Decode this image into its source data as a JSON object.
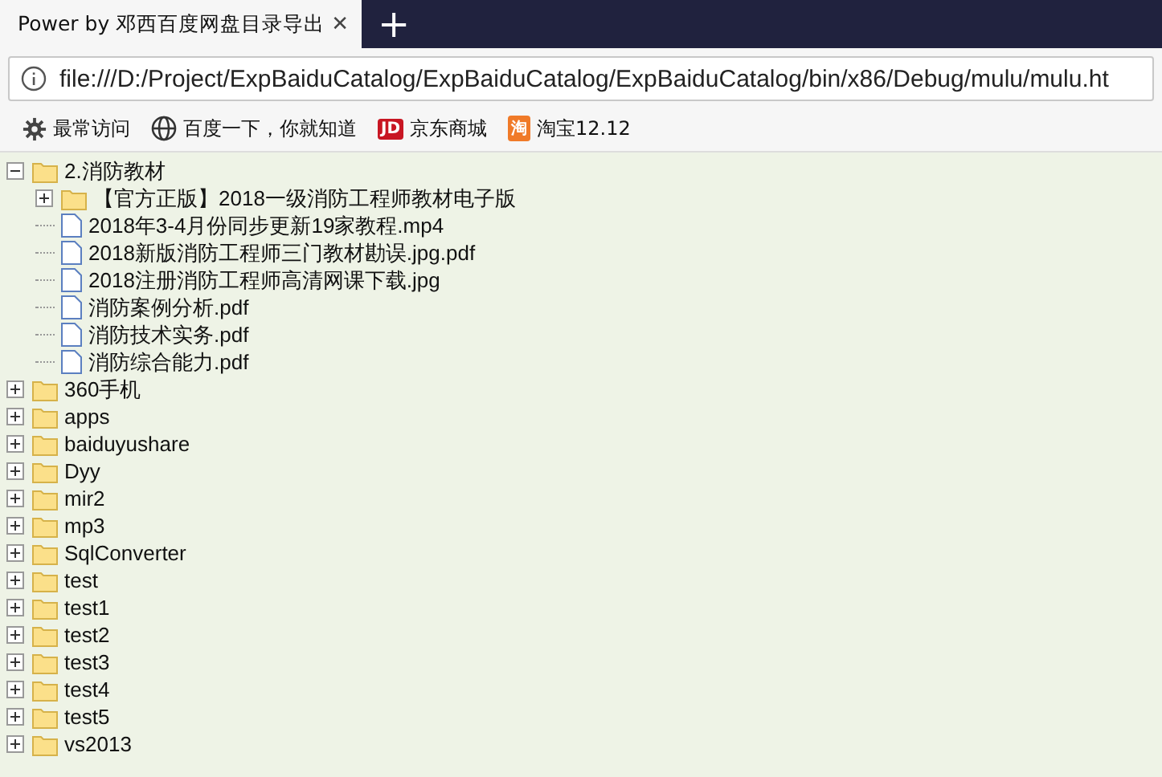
{
  "tabs": [
    {
      "title": "Power by 邓西百度网盘目录导出",
      "selected": true,
      "close": "✕"
    }
  ],
  "new_tab": "+",
  "address_bar": {
    "url": "file:///D:/Project/ExpBaiduCatalog/ExpBaiduCatalog/ExpBaiduCatalog/bin/x86/Debug/mulu/mulu.ht"
  },
  "bookmarks": [
    {
      "kind": "gear",
      "label": "最常访问"
    },
    {
      "kind": "globe",
      "label": "百度一下，你就知道"
    },
    {
      "kind": "badge",
      "badge": "JD",
      "color": "#c81623",
      "label": "京东商城"
    },
    {
      "kind": "badge",
      "badge": "淘",
      "color": "#f07a28",
      "label": "淘宝12.12"
    }
  ],
  "tree": [
    {
      "kind": "folder",
      "name": "2.消防教材",
      "expanded": true,
      "children": [
        {
          "kind": "folder",
          "name": "【官方正版】2018一级消防工程师教材电子版",
          "expanded": false
        },
        {
          "kind": "file",
          "name": "2018年3-4月份同步更新19家教程.mp4"
        },
        {
          "kind": "file",
          "name": "2018新版消防工程师三门教材勘误.jpg.pdf"
        },
        {
          "kind": "file",
          "name": "2018注册消防工程师高清网课下载.jpg"
        },
        {
          "kind": "file",
          "name": "消防案例分析.pdf"
        },
        {
          "kind": "file",
          "name": "消防技术实务.pdf"
        },
        {
          "kind": "file",
          "name": "消防综合能力.pdf"
        }
      ]
    },
    {
      "kind": "folder",
      "name": "360手机",
      "expanded": false
    },
    {
      "kind": "folder",
      "name": "apps",
      "expanded": false
    },
    {
      "kind": "folder",
      "name": "baiduyushare",
      "expanded": false
    },
    {
      "kind": "folder",
      "name": "Dyy",
      "expanded": false
    },
    {
      "kind": "folder",
      "name": "mir2",
      "expanded": false
    },
    {
      "kind": "folder",
      "name": "mp3",
      "expanded": false
    },
    {
      "kind": "folder",
      "name": "SqlConverter",
      "expanded": false
    },
    {
      "kind": "folder",
      "name": "test",
      "expanded": false
    },
    {
      "kind": "folder",
      "name": "test1",
      "expanded": false
    },
    {
      "kind": "folder",
      "name": "test2",
      "expanded": false
    },
    {
      "kind": "folder",
      "name": "test3",
      "expanded": false
    },
    {
      "kind": "folder",
      "name": "test4",
      "expanded": false
    },
    {
      "kind": "folder",
      "name": "test5",
      "expanded": false
    },
    {
      "kind": "folder",
      "name": "vs2013",
      "expanded": false
    }
  ]
}
